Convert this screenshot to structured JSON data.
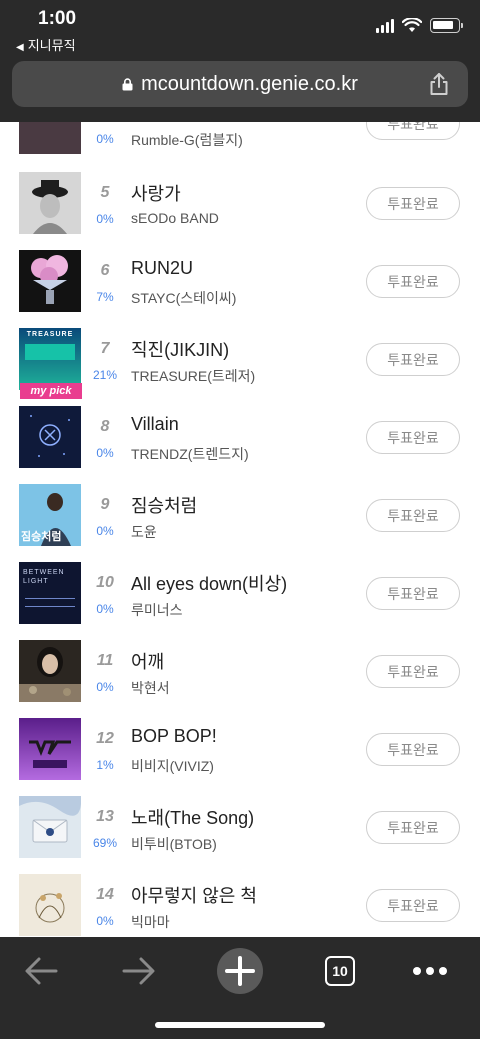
{
  "status_bar": {
    "time": "1:00",
    "back_app": "지니뮤직"
  },
  "browser": {
    "url": "mcountdown.genie.co.kr",
    "tab_count": "10"
  },
  "vote_items": [
    {
      "rank": "",
      "percent": "0%",
      "title": "",
      "artist": "Rumble-G(럼블지)",
      "button": "투표완료"
    },
    {
      "rank": "5",
      "percent": "0%",
      "title": "사랑가",
      "artist": "sEODo BAND",
      "button": "투표완료"
    },
    {
      "rank": "6",
      "percent": "7%",
      "title": "RUN2U",
      "artist": "STAYC(스테이씨)",
      "button": "투표완료"
    },
    {
      "rank": "7",
      "percent": "21%",
      "title": "직진(JIKJIN)",
      "artist": "TREASURE(트레저)",
      "button": "투표완료",
      "badge": "my pick",
      "thumb_text": "TREASURE"
    },
    {
      "rank": "8",
      "percent": "0%",
      "title": "Villain",
      "artist": "TRENDZ(트렌드지)",
      "button": "투표완료"
    },
    {
      "rank": "9",
      "percent": "0%",
      "title": "짐승처럼",
      "artist": "도윤",
      "button": "투표완료",
      "thumb_text": "짐승처럼"
    },
    {
      "rank": "10",
      "percent": "0%",
      "title": "All eyes down(비상)",
      "artist": "루미너스",
      "button": "투표완료",
      "thumb_text": "BETWEEN LIGHT"
    },
    {
      "rank": "11",
      "percent": "0%",
      "title": "어깨",
      "artist": "박현서",
      "button": "투표완료"
    },
    {
      "rank": "12",
      "percent": "1%",
      "title": "BOP BOP!",
      "artist": "비비지(VIVIZ)",
      "button": "투표완료"
    },
    {
      "rank": "13",
      "percent": "69%",
      "title": "노래(The Song)",
      "artist": "비투비(BTOB)",
      "button": "투표완료"
    },
    {
      "rank": "14",
      "percent": "0%",
      "title": "아무렇지 않은 척",
      "artist": "빅마마",
      "button": "투표완료"
    }
  ],
  "colors": {
    "percent": "#4a86e8",
    "badge": "#e93d8f",
    "chrome": "#2a2a2a"
  },
  "icons": [
    "back-arrow-icon",
    "forward-arrow-icon",
    "new-tab-plus-icon",
    "tabs-icon",
    "more-icon",
    "share-icon",
    "lock-icon",
    "wifi-icon",
    "signal-icon",
    "battery-icon"
  ]
}
